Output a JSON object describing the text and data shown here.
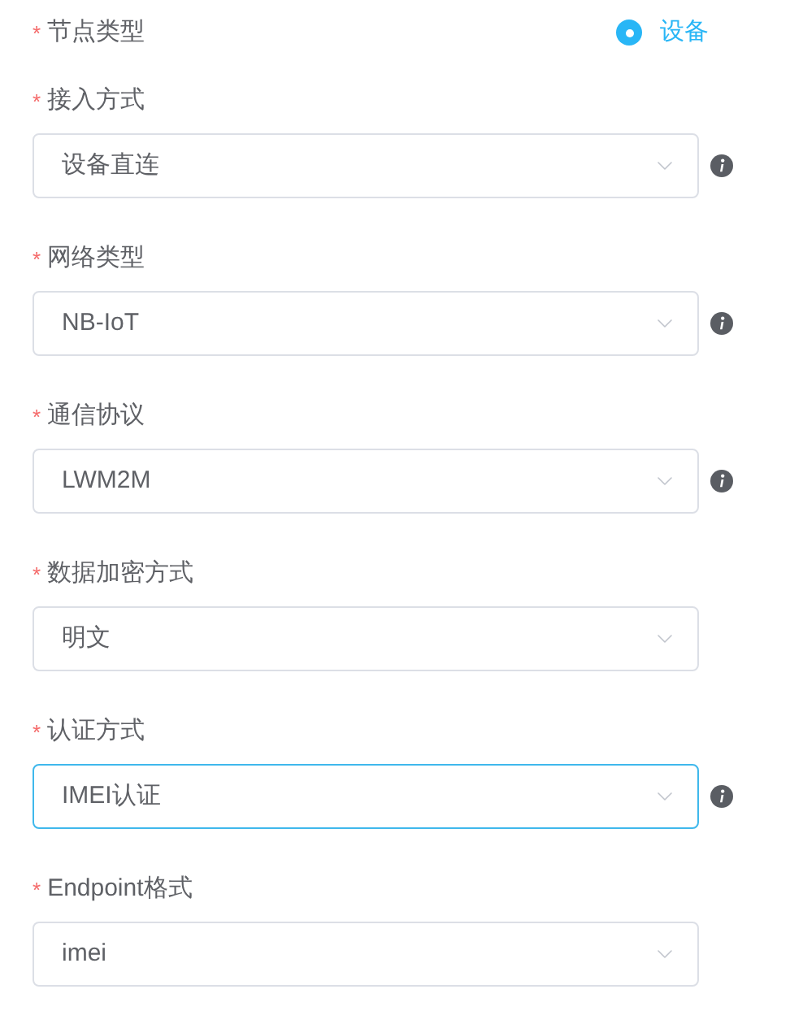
{
  "node_type": {
    "label": "节点类型",
    "required_mark": "*",
    "option": {
      "label": "设备",
      "selected": true
    }
  },
  "fields": [
    {
      "label": "接入方式",
      "required_mark": "*",
      "value": "设备直连",
      "focused": false,
      "info": true
    },
    {
      "label": "网络类型",
      "required_mark": "*",
      "value": "NB-IoT",
      "focused": false,
      "info": true
    },
    {
      "label": "通信协议",
      "required_mark": "*",
      "value": "LWM2M",
      "focused": false,
      "info": true
    },
    {
      "label": "数据加密方式",
      "required_mark": "*",
      "value": "明文",
      "focused": false,
      "info": false
    },
    {
      "label": "认证方式",
      "required_mark": "*",
      "value": "IMEI认证",
      "focused": true,
      "info": true
    },
    {
      "label": "Endpoint格式",
      "required_mark": "*",
      "value": "imei",
      "focused": false,
      "info": false
    }
  ]
}
